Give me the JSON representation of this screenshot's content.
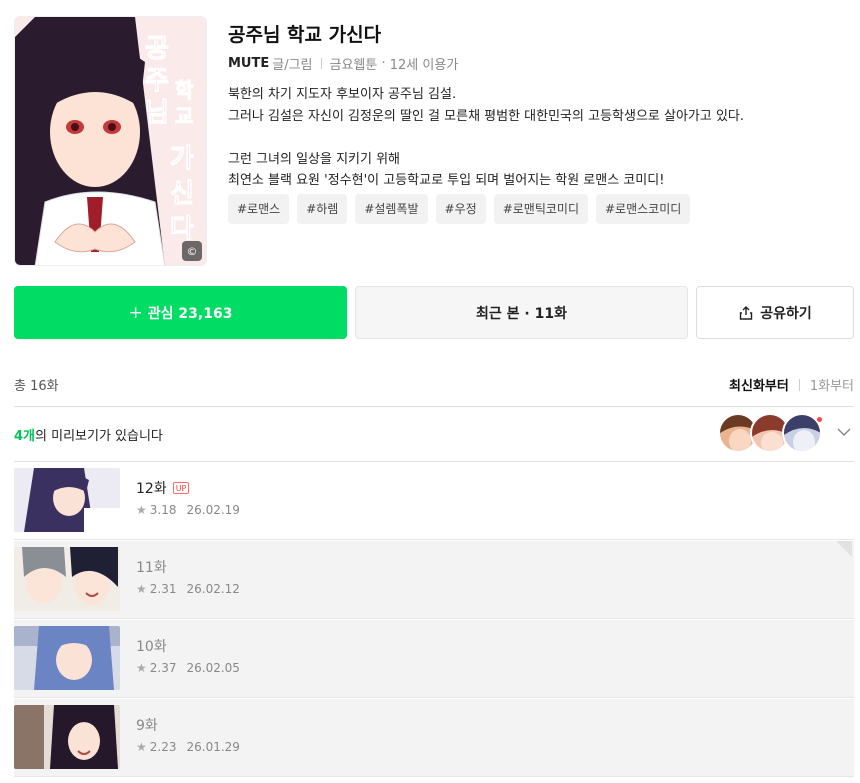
{
  "title": "공주님 학교 가신다",
  "author": "MUTE",
  "author_role": "글/그림",
  "day": "금요웹툰",
  "age": "12세 이용가",
  "cover_title_art": "공주님 학교 가신다",
  "synopsis": [
    "북한의 차기 지도자 후보이자 공주님 김설.",
    "그러나 김설은 자신이 김정운의 딸인 걸 모른채 평범한 대한민국의 고등학생으로 살아가고 있다.",
    "",
    "그런 그녀의 일상을 지키기 위해",
    "최연소 블랙 요원 '정수현'이 고등학교로 투입 되며 벌어지는 학원 로맨스 코미디!"
  ],
  "tags": [
    "#로맨스",
    "#하렘",
    "#설렘폭발",
    "#우정",
    "#로맨틱코미디",
    "#로맨스코미디"
  ],
  "buttons": {
    "like_label": "관심 23,163",
    "recent_label": "최근 본 · 11화",
    "share_label": "공유하기"
  },
  "list": {
    "total": "총 16화",
    "sort_newest": "최신화부터",
    "sort_first": "1화부터"
  },
  "preview": {
    "count": "4개",
    "text": "의 미리보기가 있습니다"
  },
  "episodes": [
    {
      "title": "12화",
      "badge": "UP",
      "rating": "3.18",
      "date": "26.02.19",
      "read": false
    },
    {
      "title": "11화",
      "badge": "",
      "rating": "2.31",
      "date": "26.02.12",
      "read": true
    },
    {
      "title": "10화",
      "badge": "",
      "rating": "2.37",
      "date": "26.02.05",
      "read": true
    },
    {
      "title": "9화",
      "badge": "",
      "rating": "2.23",
      "date": "26.01.29",
      "read": true
    }
  ],
  "colors": {
    "accent": "#00dc64",
    "up_badge": "#ff4545",
    "read_bg": "#f3f3f3"
  },
  "icons": {
    "plus": "plus-icon",
    "share": "share-icon",
    "chevron": "chevron-down-icon",
    "star": "star-icon",
    "bookmark": "bookmark-icon"
  }
}
